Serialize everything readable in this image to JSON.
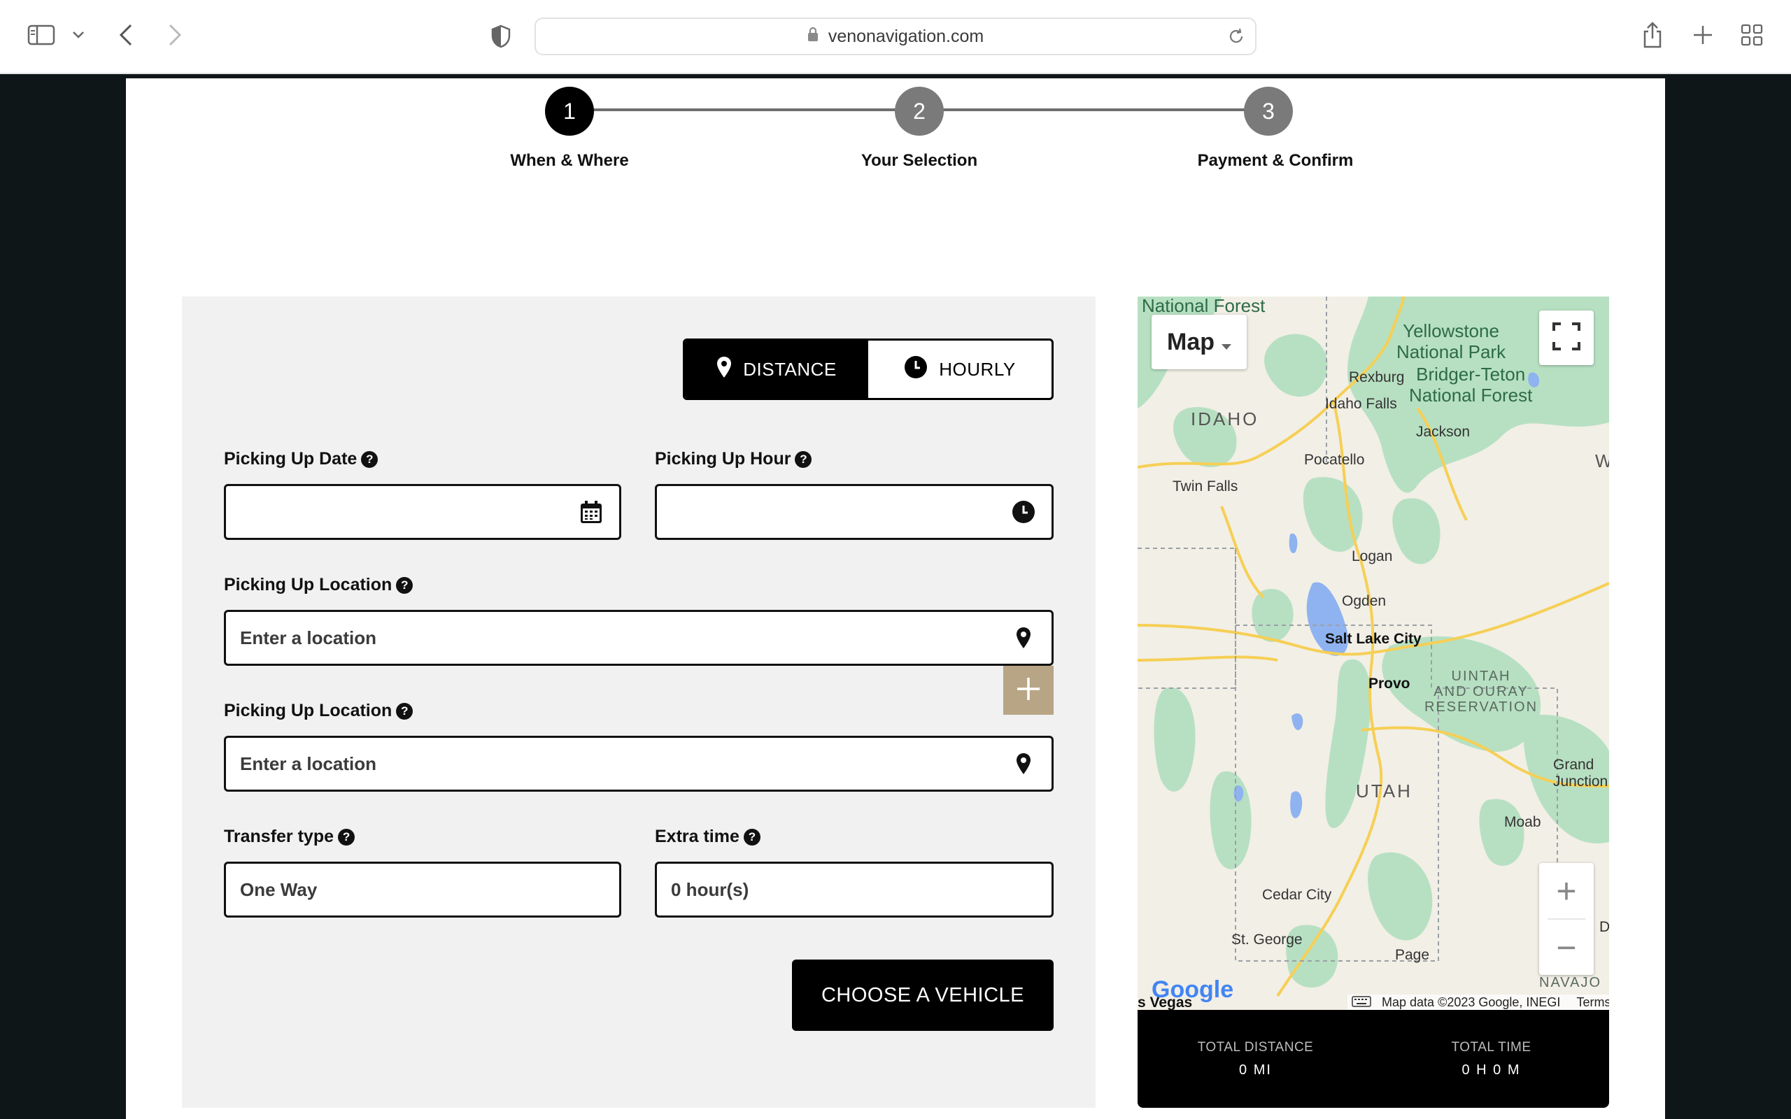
{
  "browser": {
    "url": "venonavigation.com"
  },
  "stepper": {
    "steps": [
      {
        "number": "1",
        "label": "When & Where"
      },
      {
        "number": "2",
        "label": "Your Selection"
      },
      {
        "number": "3",
        "label": "Payment & Confirm"
      }
    ],
    "active_step": 1
  },
  "form": {
    "mode_toggle": {
      "distance_label": "DISTANCE",
      "hourly_label": "HOURLY",
      "selected": "DISTANCE"
    },
    "pickup_date": {
      "label": "Picking Up Date",
      "value": ""
    },
    "pickup_hour": {
      "label": "Picking Up Hour",
      "value": ""
    },
    "pickup_location": {
      "label": "Picking Up Location",
      "placeholder": "Enter a location"
    },
    "dropoff_location": {
      "label": "Picking Up Location",
      "placeholder": "Enter a location"
    },
    "transfer_type": {
      "label": "Transfer type",
      "value": "One Way"
    },
    "extra_time": {
      "label": "Extra time",
      "value": "0 hour(s)"
    },
    "submit_label": "CHOOSE A VEHICLE"
  },
  "map": {
    "type_label": "Map",
    "labels": {
      "national_forest": "National Forest",
      "yellowstone": "Yellowstone\nNational Park",
      "bridger": "Bridger-Teton\nNational Forest",
      "rexburg": "Rexburg",
      "idaho_falls": "Idaho Falls",
      "idaho": "IDAHO",
      "jackson": "Jackson",
      "pocatello": "Pocatello",
      "twin_falls": "Twin Falls",
      "w": "W",
      "logan": "Logan",
      "ogden": "Ogden",
      "salt_lake_city": "Salt Lake City",
      "provo": "Provo",
      "uintah": "UINTAH\nAND OURAY\nRESERVATION",
      "utah": "UTAH",
      "grand_junction": "Grand\nJunction",
      "moab": "Moab",
      "cedar_city": "Cedar City",
      "st_george": "St. George",
      "page": "Page",
      "d": "D",
      "navajo": "NAVAJO",
      "las_vegas": "s Vegas"
    },
    "google_logo": "Google",
    "attribution": "Map data ©2023 Google, INEGI",
    "terms": "Terms"
  },
  "totals": {
    "distance_label": "TOTAL DISTANCE",
    "distance_value": "0 MI",
    "time_label": "TOTAL TIME",
    "time_value": "0 H 0 M"
  },
  "colors": {
    "accent_add_button": "#b8a585",
    "map_green": "#a8dcb9",
    "map_water": "#8fb3f0",
    "map_road": "#f6cf55"
  }
}
